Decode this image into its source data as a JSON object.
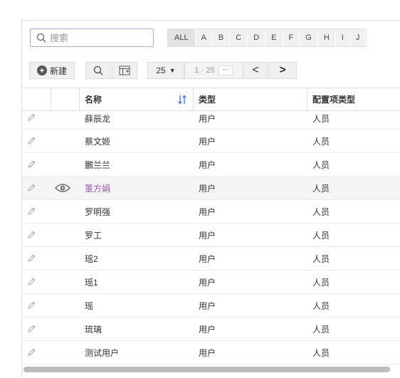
{
  "search": {
    "placeholder": "搜索",
    "value": ""
  },
  "alpha_filter": [
    "ALL",
    "A",
    "B",
    "C",
    "D",
    "E",
    "F",
    "G",
    "H",
    "I",
    "J"
  ],
  "toolbar": {
    "new_label": "新建",
    "page_size": "25",
    "page_range": "1 - 25",
    "more_label": "···"
  },
  "columns": {
    "name": "名称",
    "type": "类型",
    "config_type": "配置项类型"
  },
  "rows": [
    {
      "name": "薛辰龙",
      "type": "用户",
      "config_type": "人员"
    },
    {
      "name": "蔡文姬",
      "type": "用户",
      "config_type": "人员"
    },
    {
      "name": "鵬兰兰",
      "type": "用户",
      "config_type": "人员"
    },
    {
      "name": "董方娟",
      "type": "用户",
      "config_type": "人员"
    },
    {
      "name": "罗明强",
      "type": "用户",
      "config_type": "人员"
    },
    {
      "name": "罗工",
      "type": "用户",
      "config_type": "人员"
    },
    {
      "name": "瑶2",
      "type": "用户",
      "config_type": "人员"
    },
    {
      "name": "瑶1",
      "type": "用户",
      "config_type": "人员"
    },
    {
      "name": "瑶",
      "type": "用户",
      "config_type": "人员"
    },
    {
      "name": "琉璃",
      "type": "用户",
      "config_type": "人员"
    },
    {
      "name": "测试用户",
      "type": "用户",
      "config_type": "人员"
    }
  ],
  "highlighted_row": 3,
  "colors": {
    "accent": "#9b59b6",
    "search_border": "#c79fd8",
    "sort_icon": "#3a7bd5"
  }
}
